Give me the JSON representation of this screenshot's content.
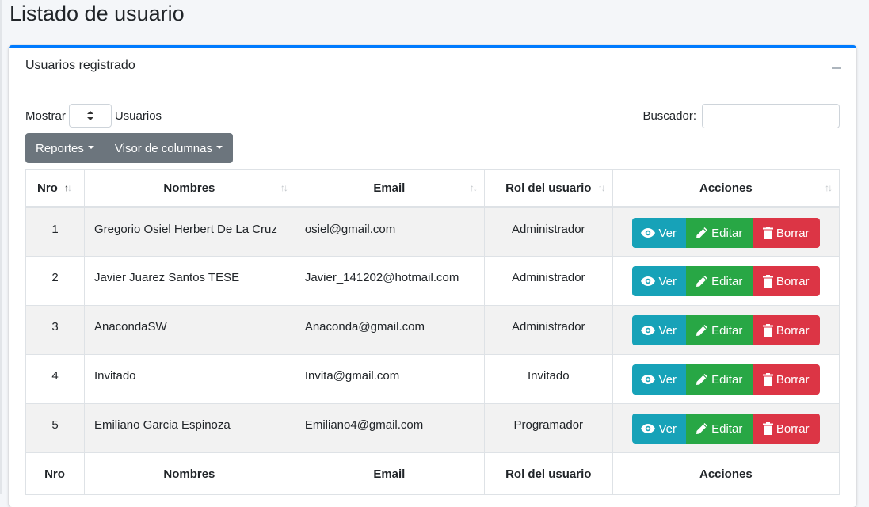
{
  "page": {
    "title": "Listado de usuario"
  },
  "card": {
    "title": "Usuarios registrado"
  },
  "controls": {
    "show_label": "Mostrar",
    "show_suffix": "Usuarios",
    "search_label": "Buscador:",
    "search_value": ""
  },
  "toolbar": {
    "reports": "Reportes",
    "columns": "Visor de columnas"
  },
  "table": {
    "headers": [
      "Nro",
      "Nombres",
      "Email",
      "Rol del usuario",
      "Acciones"
    ],
    "rows": [
      {
        "nro": "1",
        "nombre": "Gregorio Osiel Herbert De La Cruz",
        "email": "osiel@gmail.com",
        "rol": "Administrador"
      },
      {
        "nro": "2",
        "nombre": "Javier Juarez Santos TESE",
        "email": "Javier_141202@hotmail.com",
        "rol": "Administrador"
      },
      {
        "nro": "3",
        "nombre": "AnacondaSW",
        "email": "Anaconda@gmail.com",
        "rol": "Administrador"
      },
      {
        "nro": "4",
        "nombre": "Invitado",
        "email": "Invita@gmail.com",
        "rol": "Invitado"
      },
      {
        "nro": "5",
        "nombre": "Emiliano Garcia Espinoza",
        "email": "Emiliano4@gmail.com",
        "rol": "Programador"
      }
    ],
    "actions": {
      "view": "Ver",
      "edit": "Editar",
      "delete": "Borrar"
    }
  },
  "colors": {
    "primary": "#007bff",
    "info": "#17a2b8",
    "success": "#28a745",
    "danger": "#dc3545",
    "secondary": "#6c757d"
  },
  "icons": {
    "view": "eye-icon",
    "edit": "pencil-icon",
    "delete": "trash-icon",
    "sort": "sort-arrows-icon",
    "collapse": "minus-icon"
  }
}
